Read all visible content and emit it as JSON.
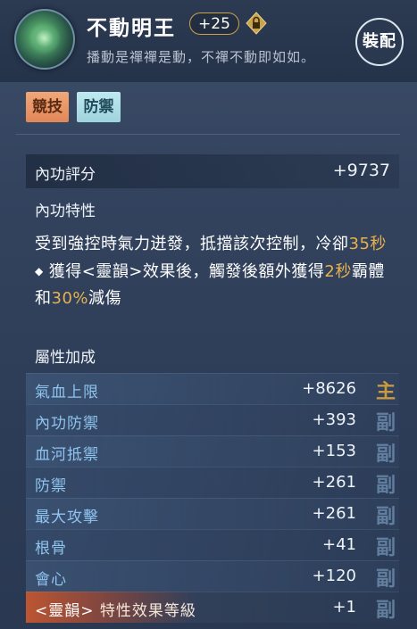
{
  "item": {
    "name": "不動明王",
    "level": "+25",
    "description": "播動是禪禪是動，不禪不動即如如。",
    "equip_label": "裝配"
  },
  "tags": [
    "競技",
    "防禦"
  ],
  "score": {
    "label": "內功評分",
    "value": "+9737"
  },
  "trait": {
    "title": "內功特性",
    "line1_a": "受到強控時氣力迸發，抵擋該次控制，冷卻",
    "line1_hl": "35秒",
    "line2_a": "獲得<靈韻>效果後，觸發後額外獲得",
    "line2_hl1": "2秒",
    "line2_b": "霸體和",
    "line2_hl2": "30%",
    "line2_c": "減傷"
  },
  "attributes": {
    "title": "屬性加成",
    "rows": [
      {
        "name": "氣血上限",
        "value": "+8626",
        "mark": "主"
      },
      {
        "name": "內功防禦",
        "value": "+393",
        "mark": "副"
      },
      {
        "name": "血河抵禦",
        "value": "+153",
        "mark": "副"
      },
      {
        "name": "防禦",
        "value": "+261",
        "mark": "副"
      },
      {
        "name": "最大攻擊",
        "value": "+261",
        "mark": "副"
      },
      {
        "name": "根骨",
        "value": "+41",
        "mark": "副"
      },
      {
        "name": "會心",
        "value": "+120",
        "mark": "副"
      },
      {
        "name_tag": "<靈韻>",
        "name": "特性效果等級",
        "value": "+1",
        "mark": "副"
      }
    ]
  },
  "colors": {
    "highlight": "#e7b14f",
    "attr_name": "#8fc4ef",
    "tag_competitive": "#e2875a",
    "tag_defense": "#9fd3de"
  },
  "icons": {
    "lock": "lock-icon",
    "gem": "gem-icon"
  }
}
